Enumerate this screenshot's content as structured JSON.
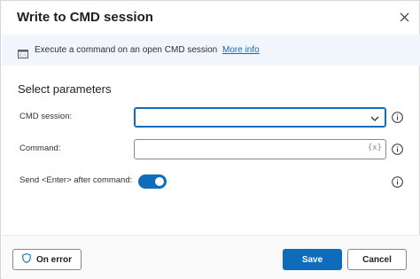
{
  "dialog": {
    "title": "Write to CMD session",
    "close_icon": "close-icon"
  },
  "banner": {
    "icon": "cmd-icon",
    "text": "Execute a command on an open CMD session",
    "link": "More info"
  },
  "parameters": {
    "section_title": "Select parameters",
    "cmd_session": {
      "label": "CMD session:",
      "value": ""
    },
    "command": {
      "label": "Command:",
      "value": "",
      "variable_button": "{x}"
    },
    "send_enter": {
      "label": "Send <Enter> after command:",
      "enabled": true
    }
  },
  "footer": {
    "on_error_label": "On error",
    "save_label": "Save",
    "cancel_label": "Cancel"
  },
  "colors": {
    "accent": "#0f6cbd",
    "banner_bg": "#f0f6fc"
  }
}
